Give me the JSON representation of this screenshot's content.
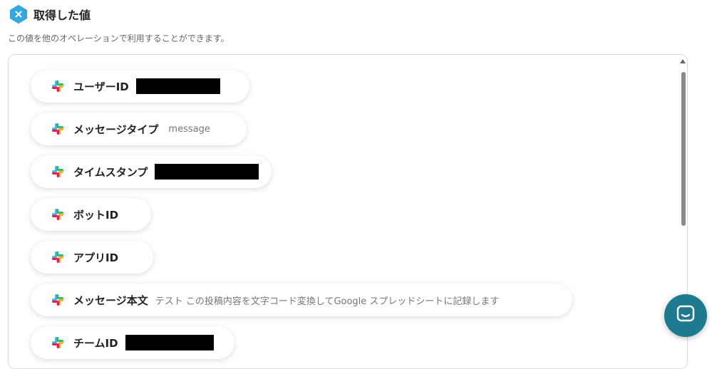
{
  "header": {
    "title": "取得した値",
    "badge_icon": "x-badge-icon"
  },
  "subtitle": "この値を他のオペレーションで利用することができます。",
  "items": [
    {
      "label": "ユーザーID",
      "value": "",
      "redacted": true
    },
    {
      "label": "メッセージタイプ",
      "value": "message",
      "redacted": false
    },
    {
      "label": "タイムスタンプ",
      "value": "",
      "redacted": true
    },
    {
      "label": "ボットID",
      "value": "",
      "redacted": false
    },
    {
      "label": "アプリID",
      "value": "",
      "redacted": false
    },
    {
      "label": "メッセージ本文",
      "value": "テスト この投稿内容を文字コード変換してGoogle スプレッドシートに記録します",
      "redacted": false
    },
    {
      "label": "チームID",
      "value": "",
      "redacted": true
    }
  ],
  "colors": {
    "accent": "#1e7b8f",
    "badge": "#33a8e0"
  },
  "chat_button": {
    "icon": "chat-icon"
  }
}
